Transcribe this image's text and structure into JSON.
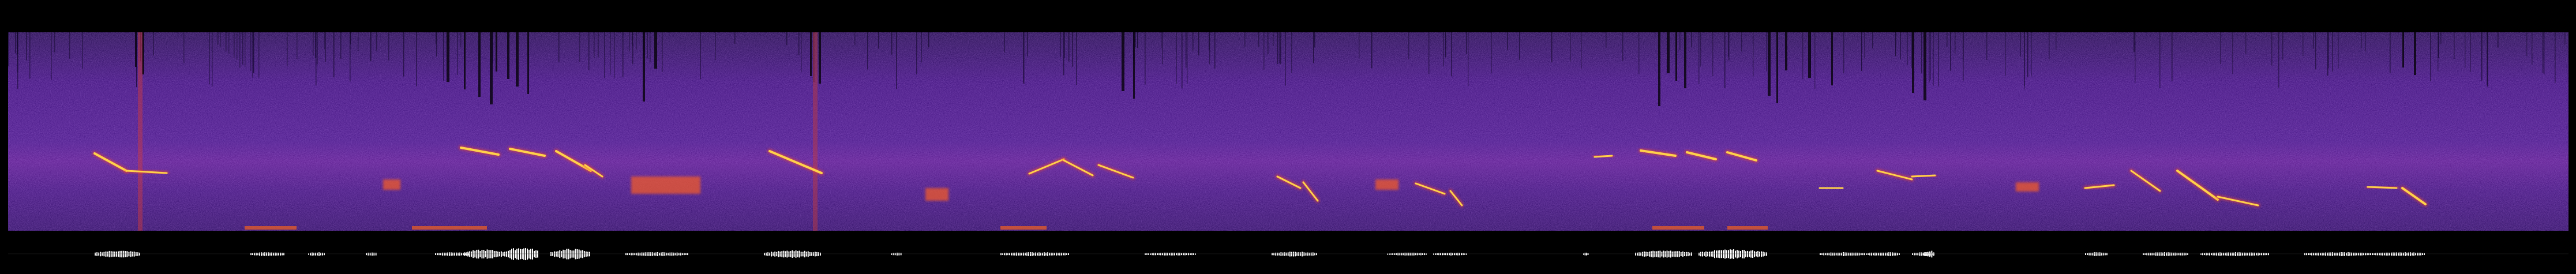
{
  "spectrogram": {
    "colormap": "magma",
    "background": "#2a0a5e",
    "high_color": "#ffd24a",
    "mid_color": "#f04a2a",
    "low_color": "#6a1ca0"
  },
  "waveform": {
    "color": "#ffffff"
  },
  "page": {
    "background": "#000000"
  }
}
